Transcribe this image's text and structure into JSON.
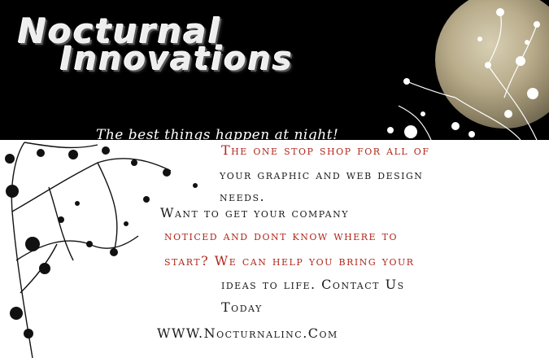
{
  "banner": {
    "title_line1": "Nocturnal",
    "title_line2": "Innovations",
    "tagline": "The best things happen at night!"
  },
  "body": {
    "line1": "The one stop shop for all of",
    "line2": "your graphic and web design",
    "line3": "needs.",
    "line4": "Want to get your company",
    "line5": "noticed and dont know where to",
    "line6": "start? We can help you bring your",
    "line7": "ideas to life. Contact Us",
    "line8": "Today",
    "website": "WWW.Nocturnalinc.Com"
  },
  "colors": {
    "banner_bg": "#000000",
    "accent_red": "#b0271b",
    "text_dark": "#1a1a1a"
  }
}
